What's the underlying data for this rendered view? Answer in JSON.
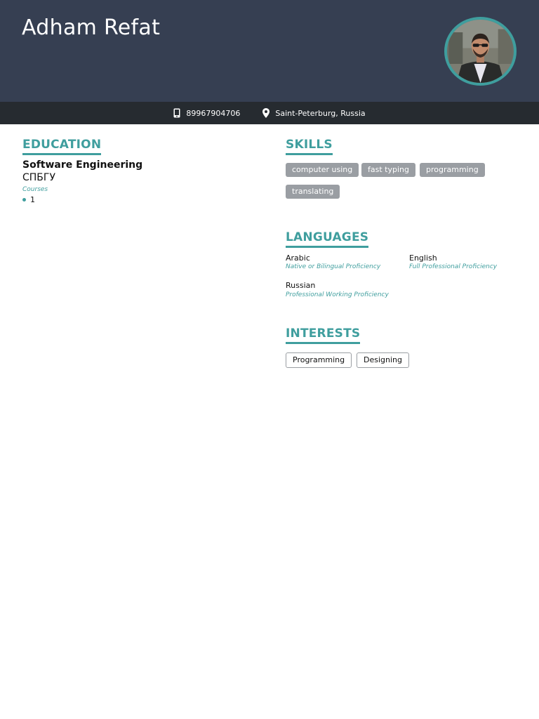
{
  "header": {
    "name": "Adham Refat"
  },
  "contact": {
    "phone": "89967904706",
    "location": "Saint-Peterburg, Russia"
  },
  "education": {
    "title": "EDUCATION",
    "degree": "Software Engineering",
    "school": "СПБГУ",
    "courses_label": "Courses",
    "courses": [
      "1"
    ]
  },
  "skills": {
    "title": "SKILLS",
    "items": [
      "computer using",
      "fast typing",
      "programming",
      "translating"
    ]
  },
  "languages": {
    "title": "LANGUAGES",
    "items": [
      {
        "name": "Arabic",
        "level": "Native or Bilingual Proficiency"
      },
      {
        "name": "English",
        "level": "Full Professional Proficiency"
      },
      {
        "name": "Russian",
        "level": "Professional Working Proficiency"
      }
    ]
  },
  "interests": {
    "title": "INTERESTS",
    "items": [
      "Programming",
      "Designing"
    ]
  },
  "colors": {
    "header_bg": "#363f52",
    "contact_bar_bg": "#262b30",
    "accent": "#3f9e9e",
    "tag_bg": "#9a9ea3"
  }
}
